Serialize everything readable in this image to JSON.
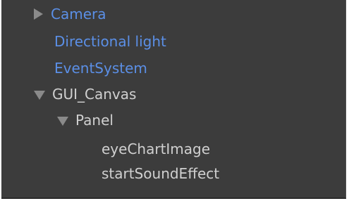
{
  "hierarchy": {
    "items": [
      {
        "label": "Camera",
        "arrow": "collapsed",
        "color": "#5b8fe6"
      },
      {
        "label": "Directional light",
        "color": "#5b8fe6"
      },
      {
        "label": "EventSystem",
        "color": "#5b8fe6"
      },
      {
        "label": "GUI_Canvas",
        "arrow": "expanded",
        "color": "#d0d0d0"
      },
      {
        "label": "Panel",
        "arrow": "expanded",
        "color": "#d0d0d0"
      },
      {
        "label": "eyeChartImage",
        "color": "#d0d0d0"
      },
      {
        "label": "startSoundEffect",
        "color": "#d0d0d0"
      }
    ]
  },
  "colors": {
    "panel_background": "#3c3c3c",
    "arrow": "#8a8a8a"
  },
  "icons": {
    "collapsed": "triangle-right-icon",
    "expanded": "triangle-down-icon"
  }
}
